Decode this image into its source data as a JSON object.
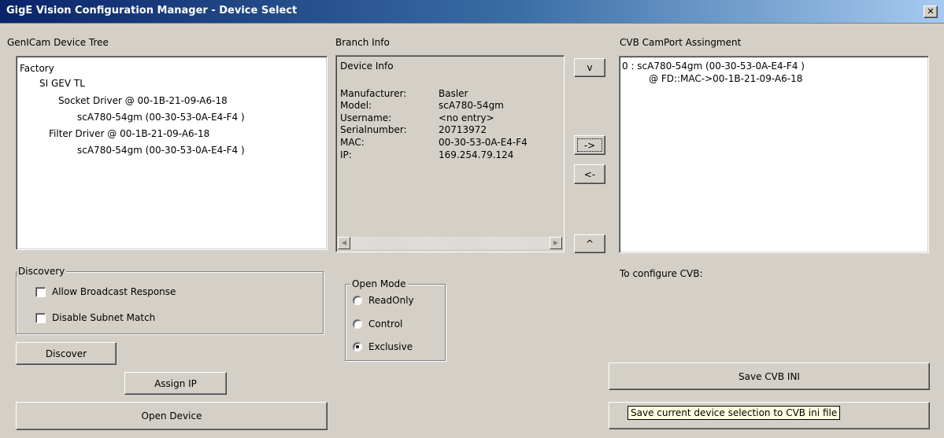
{
  "window": {
    "title": "GigE Vision Configuration Manager - Device Select",
    "close_glyph": "✕"
  },
  "device_tree": {
    "heading": "GenICam Device Tree",
    "items": [
      "Factory",
      "SI GEV TL",
      "Socket Driver @ 00-1B-21-09-A6-18",
      "scA780-54gm (00-30-53-0A-E4-F4 )",
      "Filter Driver @ 00-1B-21-09-A6-18",
      "scA780-54gm (00-30-53-0A-E4-F4 )"
    ]
  },
  "branch_info": {
    "heading": "Branch Info",
    "section_title": "Device Info",
    "rows": [
      {
        "key": "Manufacturer:",
        "value": "Basler"
      },
      {
        "key": "Model:",
        "value": "scA780-54gm"
      },
      {
        "key": "Username:",
        "value": "<no entry>"
      },
      {
        "key": "Serialnumber:",
        "value": "20713972"
      },
      {
        "key": "MAC:",
        "value": "00-30-53-0A-E4-F4"
      },
      {
        "key": "IP:",
        "value": "169.254.79.124"
      }
    ]
  },
  "mid_buttons": {
    "down": "v",
    "assign": "->",
    "remove": "<-",
    "up": "^"
  },
  "camport": {
    "heading": "CVB CamPort Assingment",
    "line1": "0 : scA780-54gm (00-30-53-0A-E4-F4 )",
    "line2": "@ FD::MAC->00-1B-21-09-A6-18"
  },
  "discovery": {
    "title": "Discovery",
    "allow_broadcast": "Allow Broadcast Response",
    "disable_subnet": "Disable Subnet Match"
  },
  "open_mode": {
    "title": "Open Mode",
    "options": [
      "ReadOnly",
      "Control",
      "Exclusive"
    ],
    "selected": "Exclusive"
  },
  "buttons": {
    "discover": "Discover",
    "assign_ip": "Assign IP",
    "open_device": "Open Device",
    "save_cvb_ini": "Save CVB INI"
  },
  "configure_label": "To configure CVB:",
  "tooltip": "Save current device selection to CVB ini file"
}
